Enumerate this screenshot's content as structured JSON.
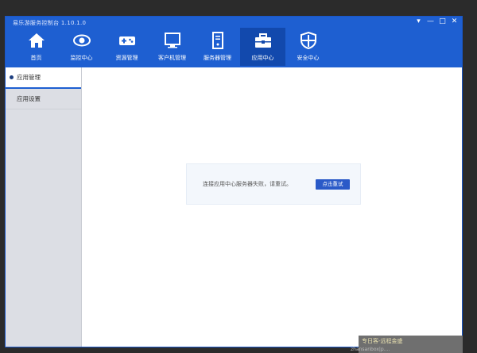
{
  "app": {
    "title": "易乐游服务控制台 1.10.1.0"
  },
  "window_controls": {
    "dropdown": "▾",
    "minimize": "—",
    "maximize": "□",
    "close": "✕"
  },
  "nav": [
    {
      "label": "首页",
      "icon": "home-icon"
    },
    {
      "label": "监控中心",
      "icon": "eye-icon"
    },
    {
      "label": "资源管理",
      "icon": "gamepad-icon"
    },
    {
      "label": "客户机管理",
      "icon": "monitor-icon"
    },
    {
      "label": "服务器管理",
      "icon": "server-icon"
    },
    {
      "label": "应用中心",
      "icon": "toolbox-icon",
      "active": true
    },
    {
      "label": "安全中心",
      "icon": "shield-icon"
    }
  ],
  "sidebar": {
    "items": [
      {
        "label": "应用管理",
        "active": true
      },
      {
        "label": "应用设置"
      }
    ]
  },
  "content": {
    "message": "连接应用中心服务器失败，请重试。",
    "retry_label": "点击重试"
  },
  "toast": {
    "text": "专日客-远程金盛"
  },
  "watermark": {
    "text": "zhansanbox|p...."
  },
  "colors": {
    "titlebar": "#1e5fd1",
    "active_tab": "#1249ad",
    "button": "#2a5ac8",
    "sidebar": "#dcdee4"
  }
}
